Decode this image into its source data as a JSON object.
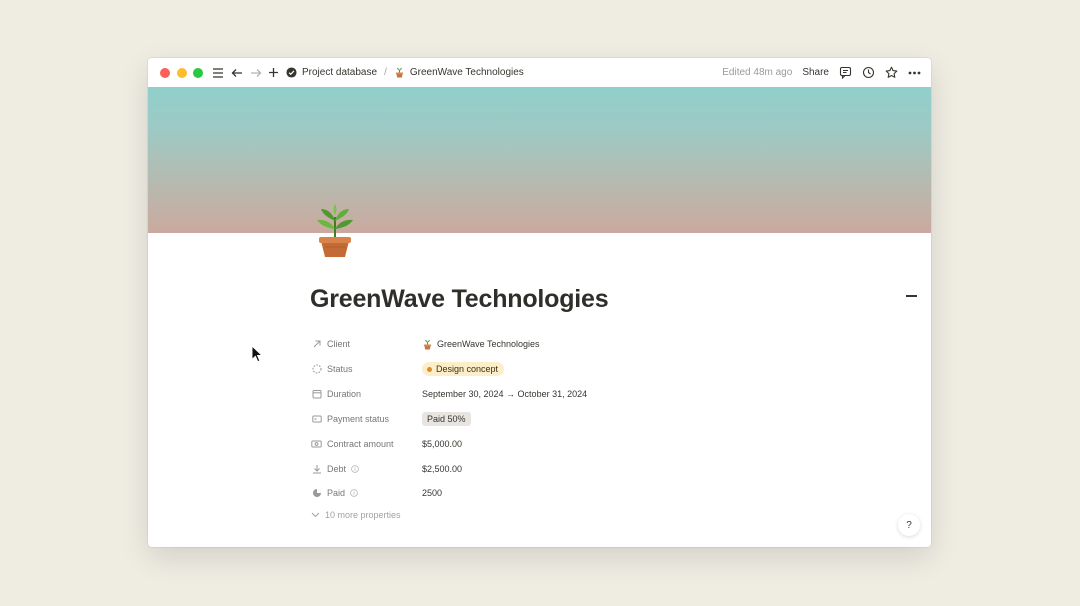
{
  "titlebar": {
    "breadcrumb_root": "Project database",
    "breadcrumb_page": "GreenWave Technologies",
    "edited": "Edited 48m ago",
    "share_label": "Share"
  },
  "page": {
    "title": "GreenWave Technologies",
    "icon": "potted-plant-icon"
  },
  "properties": [
    {
      "name": "Client",
      "icon": "arrow-up-right-icon",
      "value": "GreenWave Technologies",
      "value_icon": "potted-plant-icon"
    },
    {
      "name": "Status",
      "icon": "status-dashed-circle-icon",
      "value": "Design concept",
      "tag_color": "#fbeec8",
      "dot_color": "#d9902b"
    },
    {
      "name": "Duration",
      "icon": "calendar-icon",
      "value": "September 30, 2024 → October 31, 2024"
    },
    {
      "name": "Payment status",
      "icon": "select-list-icon",
      "value": "Paid 50%",
      "tag_color": "#e8e5e1"
    },
    {
      "name": "Contract amount",
      "icon": "banknote-icon",
      "value": "$5,000.00"
    },
    {
      "name": "Debt",
      "icon": "download-icon",
      "value": "$2,500.00",
      "has_info": true
    },
    {
      "name": "Paid",
      "icon": "pie-chart-icon",
      "value": "2500",
      "has_info": true
    }
  ],
  "more_properties": "10 more properties",
  "help_label": "?"
}
